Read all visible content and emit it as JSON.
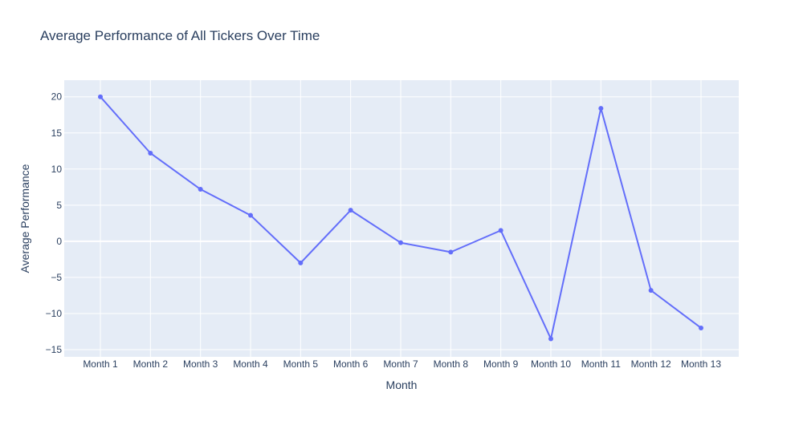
{
  "chart_data": {
    "type": "line",
    "title": "Average Performance of All Tickers Over Time",
    "xlabel": "Month",
    "ylabel": "Average Performance",
    "categories": [
      "Month 1",
      "Month 2",
      "Month 3",
      "Month 4",
      "Month 5",
      "Month 6",
      "Month 7",
      "Month 8",
      "Month 9",
      "Month 10",
      "Month 11",
      "Month 12",
      "Month 13"
    ],
    "series": [
      {
        "values": [
          20.0,
          12.2,
          7.2,
          3.6,
          -3.0,
          4.3,
          -0.2,
          -1.5,
          1.5,
          -13.5,
          18.4,
          -6.8,
          -12.0
        ]
      }
    ],
    "ylim": [
      -16.0,
      22.3
    ],
    "yticks": [
      -15,
      -10,
      -5,
      0,
      5,
      10,
      15,
      20
    ],
    "ytick_labels": [
      "−15",
      "−10",
      "−5",
      "0",
      "5",
      "10",
      "15",
      "20"
    ],
    "grid": true,
    "legend": "none",
    "colors": {
      "line": "#636efa",
      "plot_background": "#e5ecf6",
      "grid": "#ffffff",
      "text": "#2a3f5f"
    }
  }
}
